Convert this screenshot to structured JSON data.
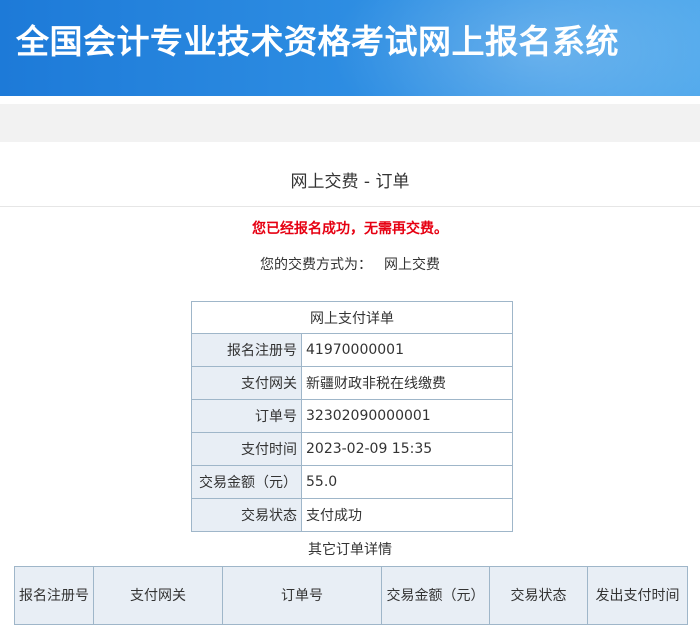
{
  "header": {
    "title": "全国会计专业技术资格考试网上报名系统"
  },
  "page": {
    "title": "网上交费 - 订单",
    "success_message": "您已经报名成功，无需再交费。",
    "payment_method_label": "您的交费方式为：",
    "payment_method_value": "网上交费"
  },
  "detail_table": {
    "caption": "网上支付详单",
    "rows": [
      {
        "label": "报名注册号",
        "value": "41970000001"
      },
      {
        "label": "支付网关",
        "value": "新疆财政非税在线缴费"
      },
      {
        "label": "订单号",
        "value": "32302090000001"
      },
      {
        "label": "支付时间",
        "value": "2023-02-09 15:35"
      },
      {
        "label": "交易金额（元）",
        "value": "55.0"
      },
      {
        "label": "交易状态",
        "value": "支付成功"
      }
    ]
  },
  "other_orders": {
    "title": "其它订单详情",
    "columns": [
      "报名注册号",
      "支付网关",
      "订单号",
      "交易金额（元）",
      "交易状态",
      "发出支付时间"
    ]
  }
}
